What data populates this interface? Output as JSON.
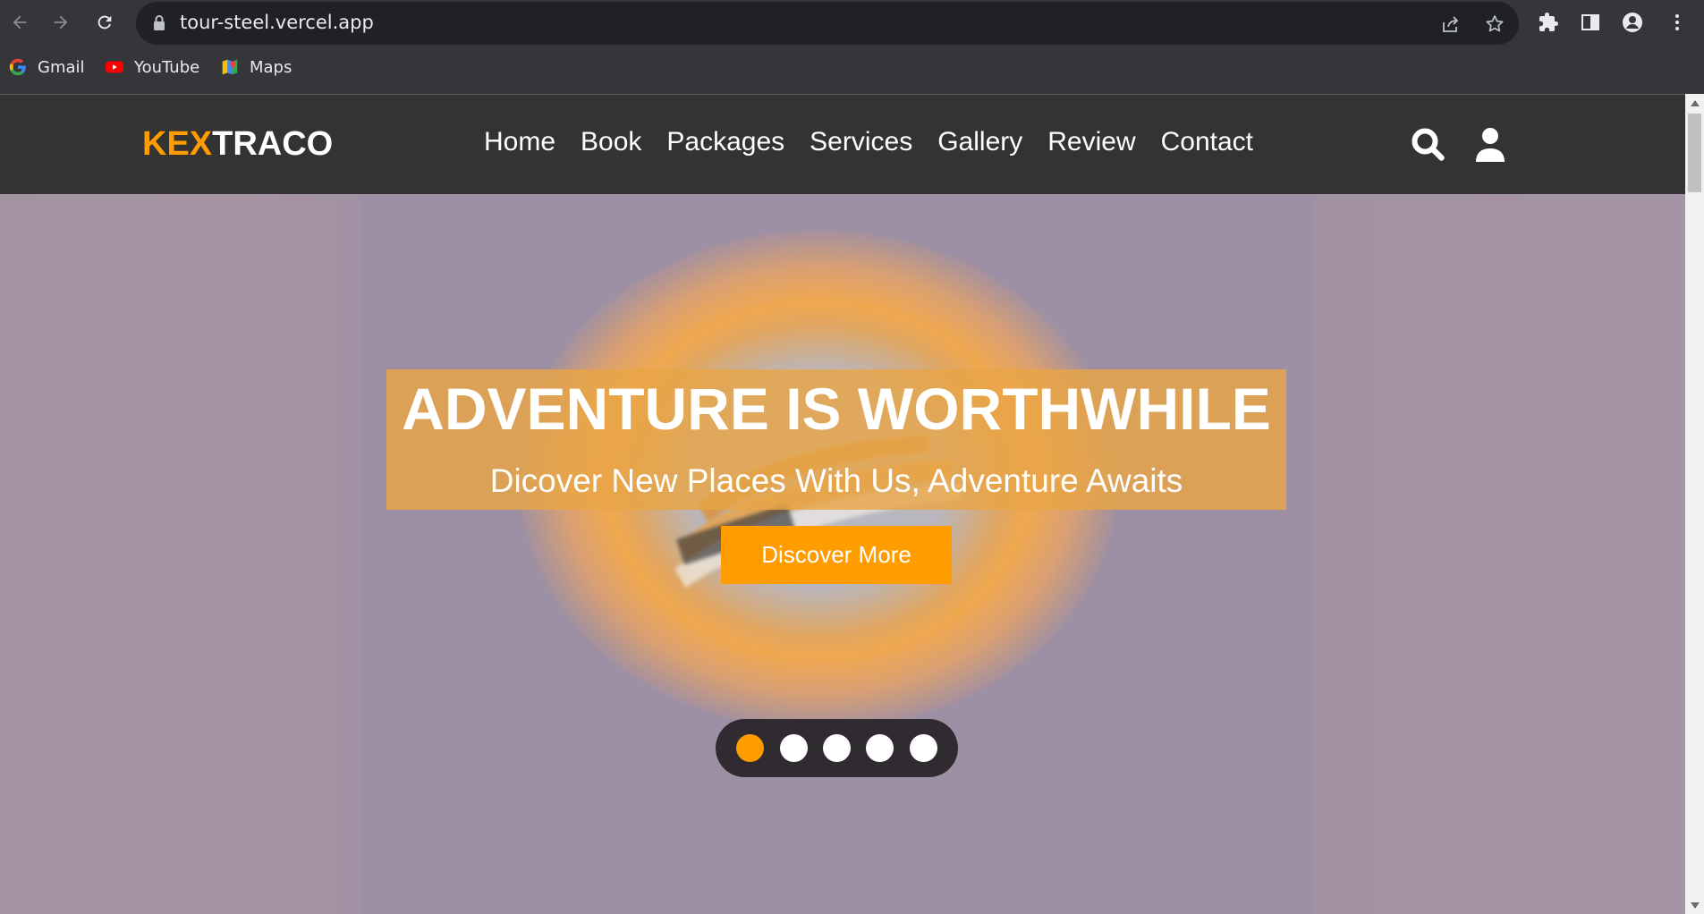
{
  "browser": {
    "url": "tour-steel.vercel.app",
    "bookmarks": [
      {
        "label": "Gmail",
        "icon": "google-icon"
      },
      {
        "label": "YouTube",
        "icon": "youtube-icon"
      },
      {
        "label": "Maps",
        "icon": "maps-icon"
      }
    ]
  },
  "site": {
    "logo_accent": "KEX",
    "logo_rest": "TRACO",
    "nav": [
      "Home",
      "Book",
      "Packages",
      "Services",
      "Gallery",
      "Review",
      "Contact"
    ],
    "header_icons": [
      "search-icon",
      "user-icon"
    ]
  },
  "hero": {
    "headline": "ADVENTURE IS WORTHWHILE",
    "subline": "Dicover New Places With Us, Adventure Awaits",
    "cta_label": "Discover More",
    "slide_count": 5,
    "active_slide": 1
  },
  "colors": {
    "accent": "#ff9d00",
    "header_bg": "#333333",
    "band": "#e8a546"
  }
}
